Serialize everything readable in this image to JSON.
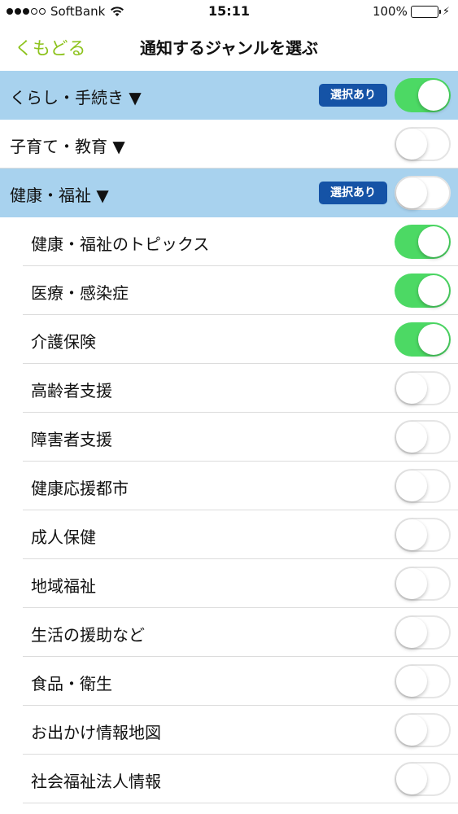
{
  "status_bar": {
    "carrier": "SoftBank",
    "time": "15:11",
    "battery": "100%"
  },
  "nav": {
    "back_label": "くもどる",
    "title": "通知するジャンルを選ぶ"
  },
  "badge_label": "選択あり",
  "colors": {
    "accent_green": "#8ec31f",
    "toggle_on": "#4cd964",
    "header_bg": "#a8d2ee",
    "badge_bg": "#1553a6"
  },
  "rows": [
    {
      "label": "くらし・手続き ▼",
      "type": "header",
      "badge": true,
      "on": true
    },
    {
      "label": "子育て・教育 ▼",
      "type": "header-white",
      "badge": false,
      "on": false
    },
    {
      "label": "健康・福祉 ▼",
      "type": "header",
      "badge": true,
      "on": false
    },
    {
      "label": "健康・福祉のトピックス",
      "type": "sub",
      "on": true
    },
    {
      "label": "医療・感染症",
      "type": "sub",
      "on": true
    },
    {
      "label": "介護保険",
      "type": "sub",
      "on": true
    },
    {
      "label": "高齢者支援",
      "type": "sub",
      "on": false
    },
    {
      "label": "障害者支援",
      "type": "sub",
      "on": false
    },
    {
      "label": "健康応援都市",
      "type": "sub",
      "on": false
    },
    {
      "label": "成人保健",
      "type": "sub",
      "on": false
    },
    {
      "label": "地域福祉",
      "type": "sub",
      "on": false
    },
    {
      "label": "生活の援助など",
      "type": "sub",
      "on": false
    },
    {
      "label": "食品・衛生",
      "type": "sub",
      "on": false
    },
    {
      "label": "お出かけ情報地図",
      "type": "sub",
      "on": false
    },
    {
      "label": "社会福祉法人情報",
      "type": "sub",
      "on": false
    }
  ]
}
